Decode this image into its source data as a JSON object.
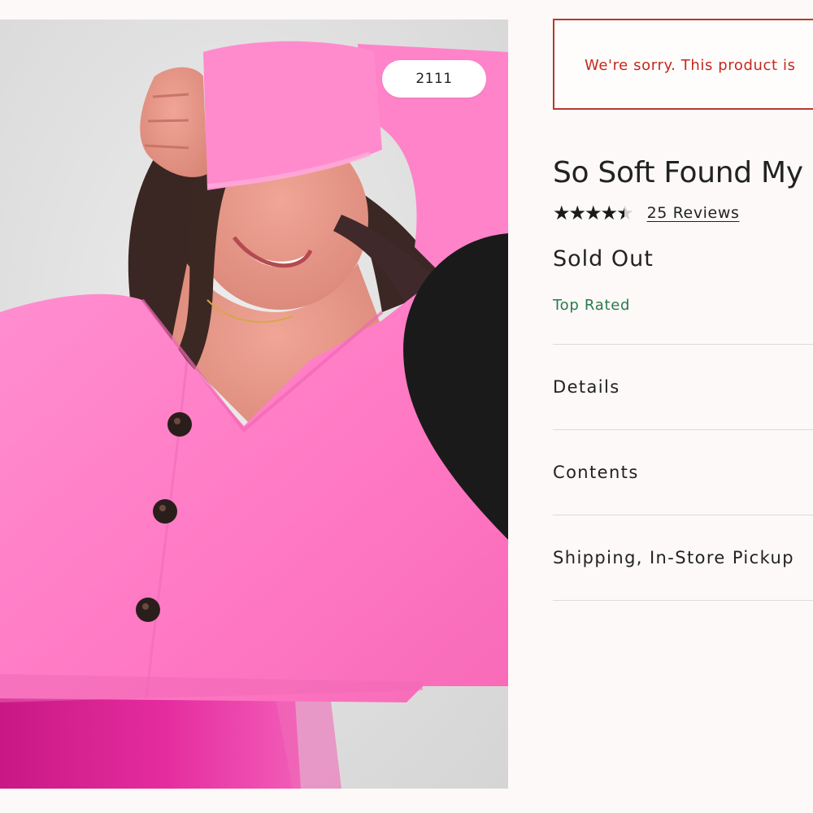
{
  "product_image": {
    "alt": "Woman wearing a fuzzy pink cardigan",
    "like_count": "2111",
    "like_icon": "heart-icon"
  },
  "notice": {
    "text": "We're sorry. This product is"
  },
  "product": {
    "title": "So Soft Found My F",
    "rating": 4.5,
    "rating_max": 5,
    "stars_glyphs": "★★★★★",
    "reviews_label": "25 Reviews",
    "availability": "Sold Out",
    "badge": "Top Rated"
  },
  "accordion": [
    {
      "label": "Details"
    },
    {
      "label": "Contents"
    },
    {
      "label": "Shipping, In-Store Pickup"
    }
  ],
  "colors": {
    "background": "#fcf9f8",
    "notice_border": "#b8382e",
    "notice_text": "#c4281e",
    "badge_green": "#2b7a4b",
    "cardigan_pink": "#ff7ec6",
    "skirt_magenta": "#e0249a"
  }
}
